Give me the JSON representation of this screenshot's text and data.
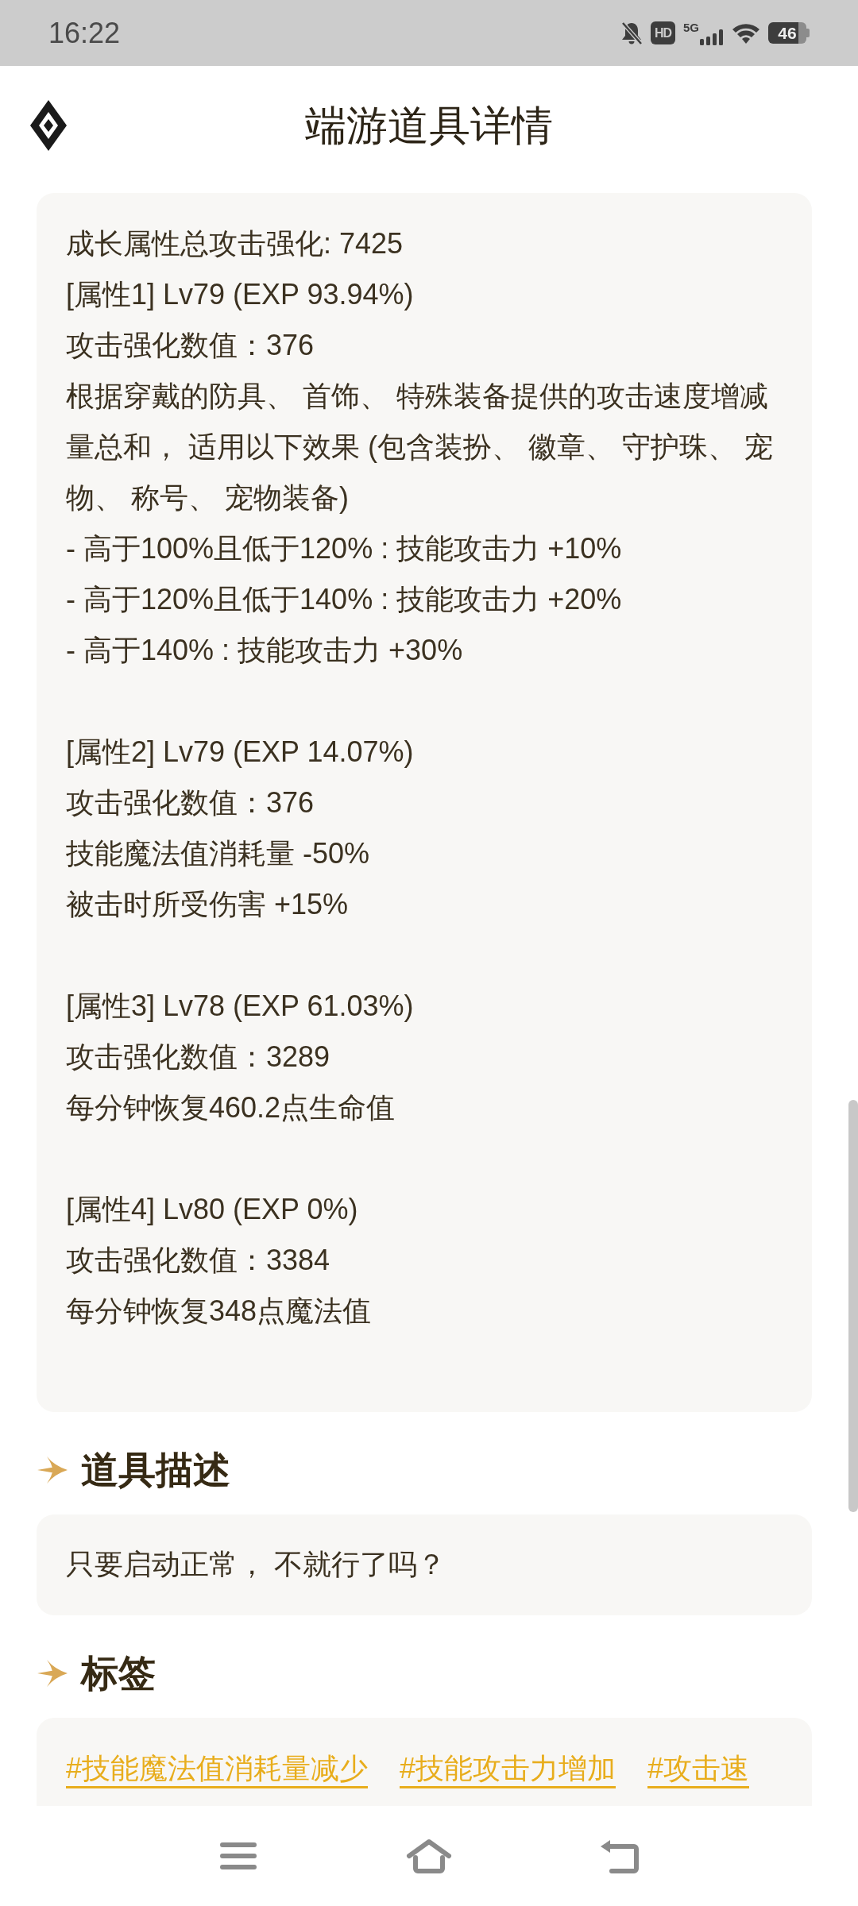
{
  "status_bar": {
    "time": "16:22",
    "hd_label": "HD",
    "network_label": "5G",
    "battery_label": "46"
  },
  "header": {
    "title": "端游道具详情"
  },
  "growth_card": {
    "summary": "成长属性总攻击强化: 7425",
    "attributes": [
      {
        "heading": "[属性1] Lv79 (EXP 93.94%)",
        "lines": [
          "攻击强化数值：376",
          "根据穿戴的防具、 首饰、 特殊装备提供的攻击速度增减量总和， 适用以下效果 (包含装扮、 徽章、 守护珠、 宠物、 称号、 宠物装备)",
          "- 高于100%且低于120% : 技能攻击力 +10%",
          "- 高于120%且低于140% : 技能攻击力 +20%",
          "- 高于140% : 技能攻击力 +30%"
        ]
      },
      {
        "heading": "[属性2] Lv79 (EXP 14.07%)",
        "lines": [
          "攻击强化数值：376",
          "技能魔法值消耗量 -50%",
          "被击时所受伤害 +15%"
        ]
      },
      {
        "heading": "[属性3] Lv78 (EXP 61.03%)",
        "lines": [
          "攻击强化数值：3289",
          "每分钟恢复460.2点生命值"
        ]
      },
      {
        "heading": "[属性4] Lv80 (EXP 0%)",
        "lines": [
          "攻击强化数值：3384",
          "每分钟恢复348点魔法值"
        ]
      }
    ]
  },
  "description": {
    "heading": "道具描述",
    "text": "只要启动正常， 不就行了吗？"
  },
  "tags": {
    "heading": "标签",
    "items": [
      "#技能魔法值消耗量减少",
      "#技能攻击力增加",
      "#攻击速"
    ]
  }
}
